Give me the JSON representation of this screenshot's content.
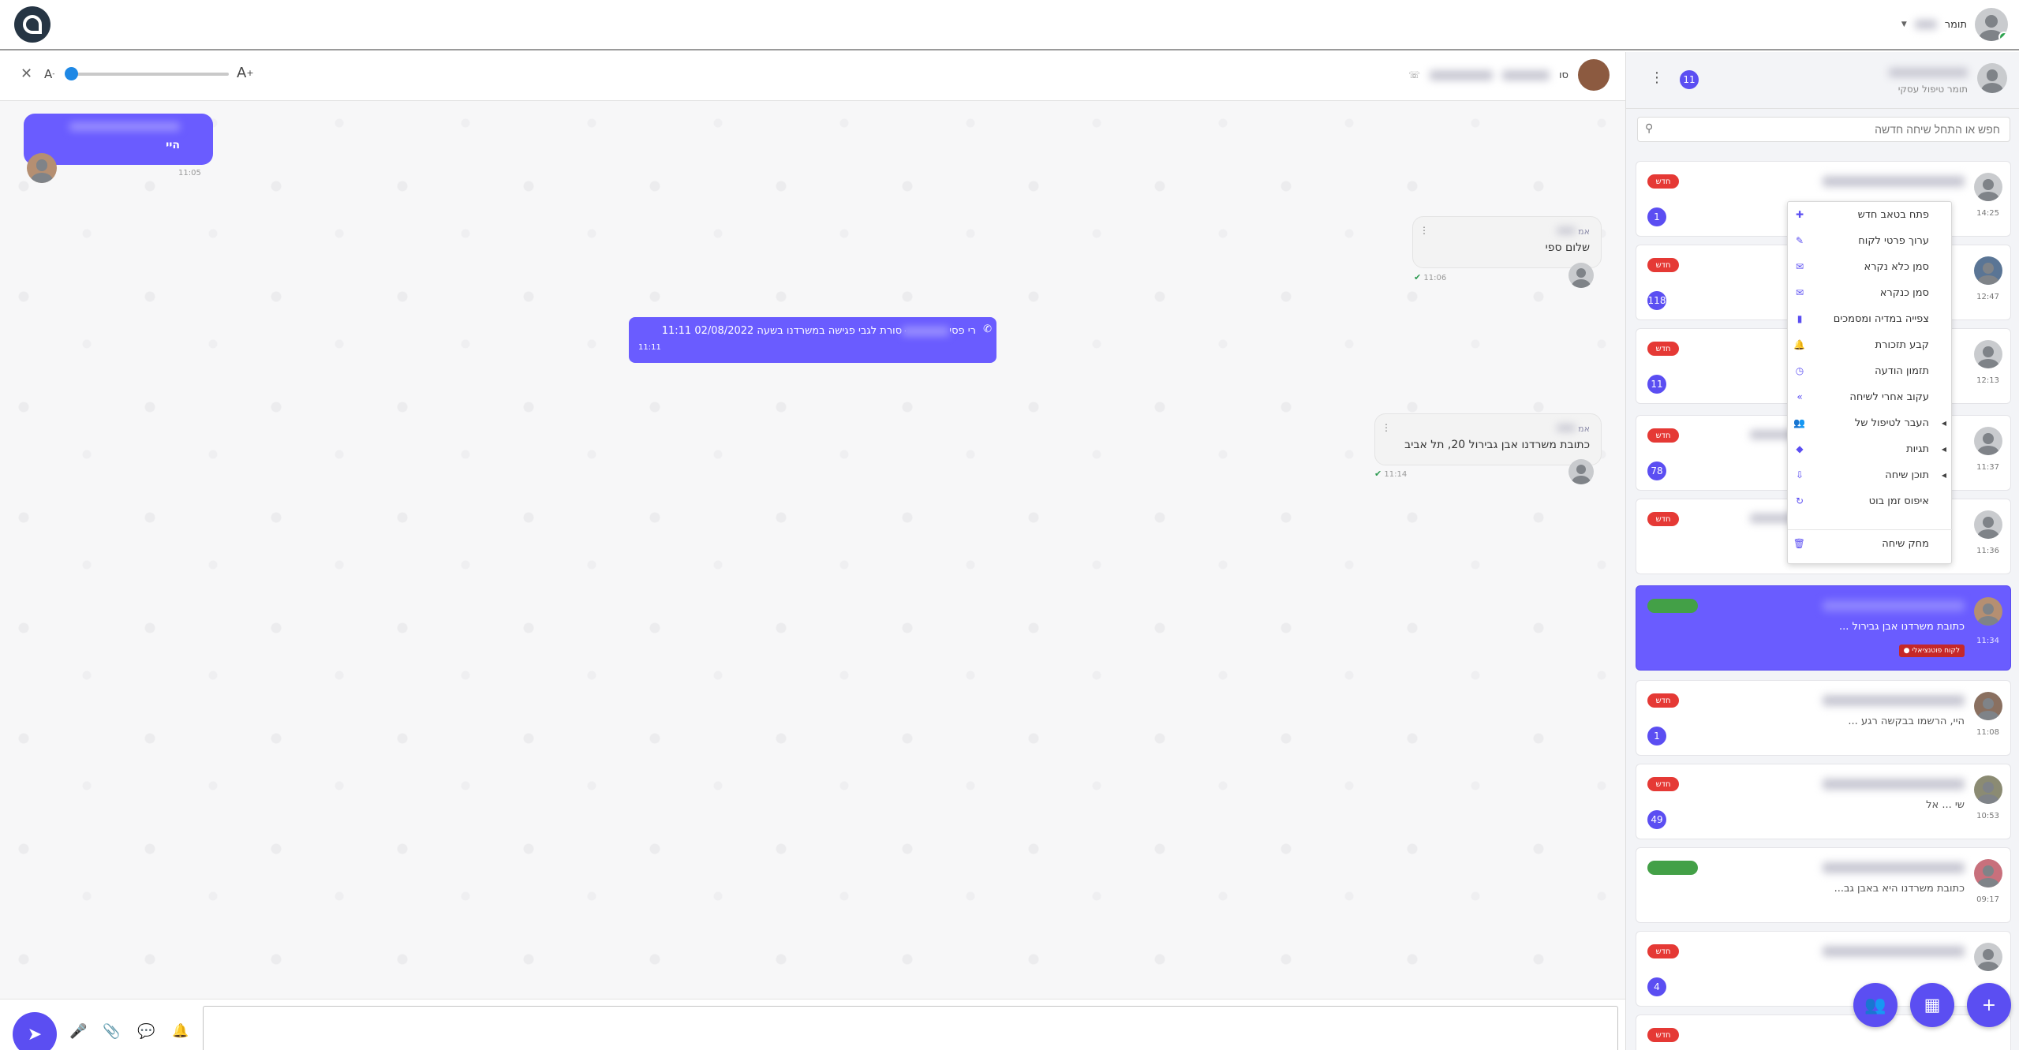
{
  "topbar": {
    "user_name": "תומר",
    "logo_icon": "qa-logo-icon"
  },
  "chat": {
    "font_small": "A",
    "font_large": "A",
    "font_small_sup": "-",
    "font_large_sup": "+",
    "header_contact_suffix": "סו",
    "messages": [
      {
        "text": "היי",
        "time": "11:05"
      },
      {
        "sender": "אמ",
        "text": "שלום ספי",
        "time": "11:06"
      },
      {
        "text_start": "רי פסי",
        "text_end": "ּסורת לגבי פגישה במשרדנו בשעה 02/08/2022 11:11",
        "time": "11:11"
      },
      {
        "sender": "אמ",
        "text": "כתובת משרדנו אבן גבירול 20, תל אביב",
        "time": "11:14"
      }
    ],
    "composer_placeholder": ""
  },
  "sidebar": {
    "subtitle": "תומר טיפול עסקי",
    "count": "11",
    "search_placeholder": "חפש או התחל שיחה חדשה",
    "new_label": "חדש",
    "conversations": [
      {
        "time": "14:25",
        "unread": "1",
        "pill": "חדש",
        "preview": ""
      },
      {
        "time": "12:47",
        "unread": "118",
        "pill": "חדש",
        "preview": ""
      },
      {
        "time": "12:13",
        "unread": "11",
        "pill": "חדש",
        "preview": ""
      },
      {
        "time": "11:37",
        "unread": "78",
        "pill": "חדש",
        "preview": ""
      },
      {
        "time": "11:36",
        "unread": "",
        "pill": "חדש",
        "preview": ""
      },
      {
        "time": "11:34",
        "unread": "",
        "pill": "",
        "preview": "כתובת משרדנו אבן גבירול ...",
        "tag": "● לקוח פוטנציאלי"
      },
      {
        "time": "11:08",
        "unread": "1",
        "pill": "חדש",
        "preview": "היי, הרשמו בבקשה רגע ..."
      },
      {
        "time": "10:53",
        "unread": "49",
        "pill": "חדש",
        "preview": "שי ... אל"
      },
      {
        "time": "09:17",
        "unread": "",
        "pill": "",
        "preview": "כתובת משרדנו היא באבן גב..."
      },
      {
        "time": "",
        "unread": "4",
        "pill": "חדש",
        "preview": ""
      }
    ]
  },
  "context_menu": {
    "items": [
      {
        "label": "פתח בטאב חדש",
        "icon": "plus-icon",
        "glyph": "✚"
      },
      {
        "label": "ערוך פרטי לקוח",
        "icon": "edit-icon",
        "glyph": "✎"
      },
      {
        "label": "סמן כלא נקרא",
        "icon": "envelope-icon",
        "glyph": "✉"
      },
      {
        "label": "סמן כנקרא",
        "icon": "envelope-open-icon",
        "glyph": "✉"
      },
      {
        "label": "צפייה במדיה ומסמכים",
        "icon": "file-icon",
        "glyph": "▮"
      },
      {
        "label": "קבע תזכורת",
        "icon": "bell-icon",
        "glyph": "🔔"
      },
      {
        "label": "תזמון הודעה",
        "icon": "clock-icon",
        "glyph": "◷"
      },
      {
        "label": "עקוב אחרי לשיחה",
        "icon": "forward-icon",
        "glyph": "»"
      },
      {
        "label": "העבר לטיפול של",
        "icon": "users-icon",
        "glyph": "👥"
      },
      {
        "label": "תגיות",
        "icon": "tag-icon",
        "glyph": "◆"
      },
      {
        "label": "תוכן שיחה",
        "icon": "download-icon",
        "glyph": "⇩"
      },
      {
        "label": "איפוס זמן בוט",
        "icon": "refresh-icon",
        "glyph": "↻"
      },
      {
        "label": "מחק שיחה",
        "icon": "trash-icon",
        "glyph": "🗑"
      }
    ]
  },
  "colors": {
    "accent": "#5b4ef2",
    "new_badge": "#e53935",
    "active_card": "#6a5cff"
  }
}
